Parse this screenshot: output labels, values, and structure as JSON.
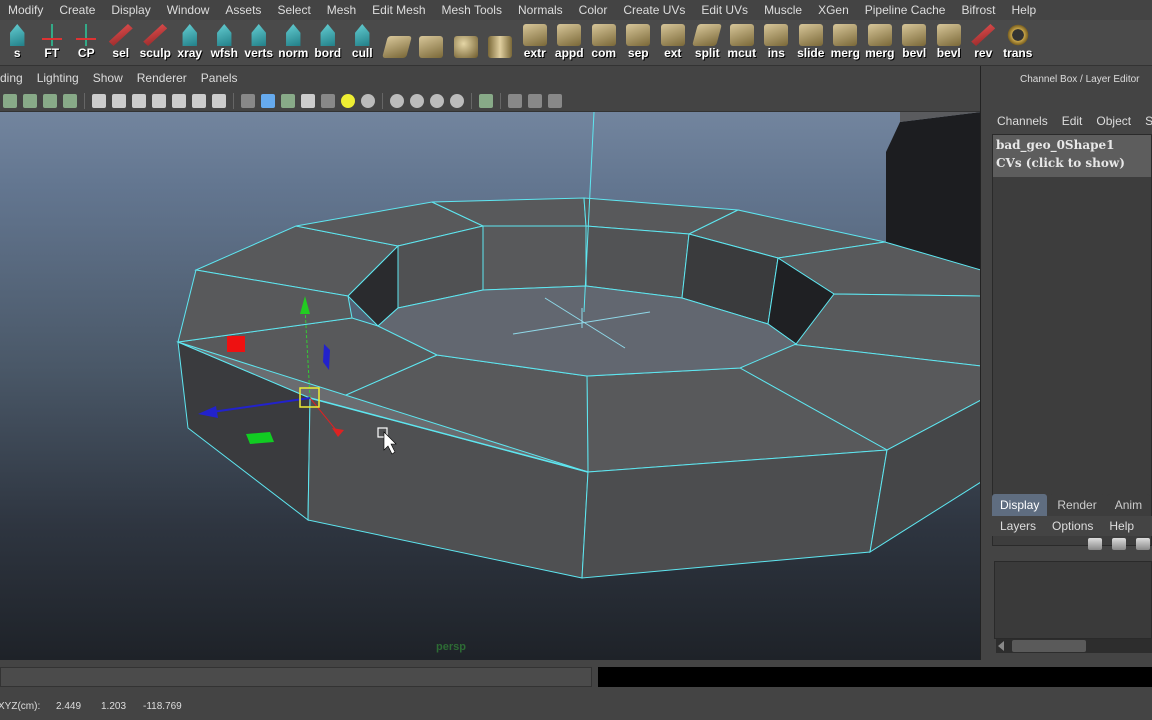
{
  "menubar": {
    "items": [
      "Modify",
      "Create",
      "Display",
      "Window",
      "Assets",
      "Select",
      "Mesh",
      "Edit Mesh",
      "Mesh Tools",
      "Normals",
      "Color",
      "Create UVs",
      "Edit UVs",
      "Muscle",
      "XGen",
      "Pipeline Cache",
      "Bifrost",
      "Help"
    ]
  },
  "shelf": {
    "tools": [
      {
        "label": "s",
        "icon": "teal"
      },
      {
        "label": "FT",
        "icon": "axis"
      },
      {
        "label": "CP",
        "icon": "axis"
      },
      {
        "label": "sel",
        "icon": "red"
      },
      {
        "label": "sculp",
        "icon": "red"
      },
      {
        "label": "xray",
        "icon": "teal"
      },
      {
        "label": "wfsh",
        "icon": "teal"
      },
      {
        "label": "verts",
        "icon": "teal"
      },
      {
        "label": "norm",
        "icon": "teal"
      },
      {
        "label": "bord",
        "icon": "teal"
      },
      {
        "label": "cull",
        "icon": "teal"
      },
      {
        "label": "",
        "icon": "tan tilt"
      },
      {
        "label": "",
        "icon": "tan"
      },
      {
        "label": "",
        "icon": "round"
      },
      {
        "label": "",
        "icon": "cyl"
      },
      {
        "label": "extr",
        "icon": "tan"
      },
      {
        "label": "appd",
        "icon": "tan"
      },
      {
        "label": "com",
        "icon": "tan"
      },
      {
        "label": "sep",
        "icon": "tan"
      },
      {
        "label": "ext",
        "icon": "tan"
      },
      {
        "label": "split",
        "icon": "tan tilt"
      },
      {
        "label": "mcut",
        "icon": "tan"
      },
      {
        "label": "ins",
        "icon": "tan"
      },
      {
        "label": "slide",
        "icon": "tan"
      },
      {
        "label": "merg",
        "icon": "tan"
      },
      {
        "label": "merg",
        "icon": "tan"
      },
      {
        "label": "bevl",
        "icon": "tan"
      },
      {
        "label": "bevl",
        "icon": "tan"
      },
      {
        "label": "rev",
        "icon": "red"
      },
      {
        "label": "trans",
        "icon": "ring"
      }
    ]
  },
  "viewport": {
    "menu": [
      "ding",
      "Lighting",
      "Show",
      "Renderer",
      "Panels"
    ],
    "camera_label": "persp"
  },
  "channel_box": {
    "title": "Channel Box / Layer Editor",
    "menu": [
      "Channels",
      "Edit",
      "Object",
      "Sho"
    ],
    "object_name": "bad_geo_0Shape1",
    "cvs_text": "CVs (click to show)"
  },
  "layer_editor": {
    "tabs": [
      "Display",
      "Render",
      "Anim"
    ],
    "active_tab": "Display",
    "menu": [
      "Layers",
      "Options",
      "Help"
    ]
  },
  "helpline": {
    "coord_label": "XYZ(cm):",
    "x": "2.449",
    "y": "1.203",
    "z": "-118.769"
  },
  "colors": {
    "wire": "#5ee6f0",
    "face": "#4f5052",
    "ui_bg": "#444444",
    "active_tab": "#5f6d80"
  }
}
